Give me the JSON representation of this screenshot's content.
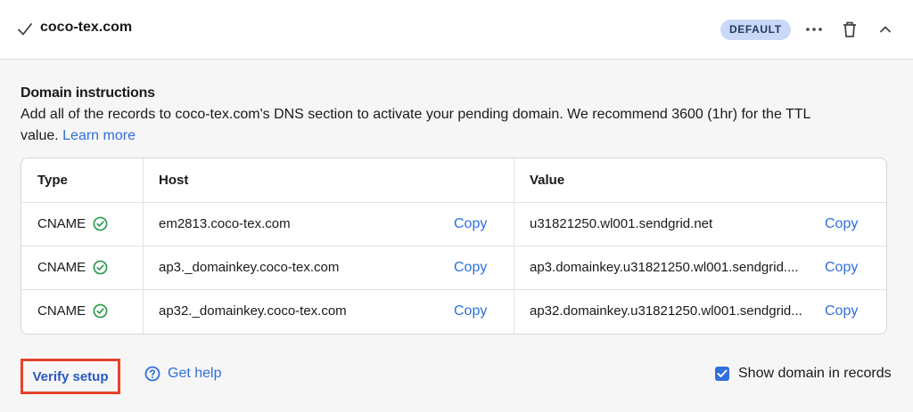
{
  "header": {
    "domain": "coco-tex.com",
    "badge": "DEFAULT",
    "icons": [
      "check-icon",
      "more-icon",
      "trash-icon",
      "chevron-up-icon"
    ]
  },
  "instructions": {
    "title": "Domain instructions",
    "text": "Add all of the records to coco-tex.com's DNS section to activate your pending domain. We recommend 3600 (1hr) for the TTL value.",
    "learn_more": "Learn more"
  },
  "table": {
    "headers": {
      "type": "Type",
      "host": "Host",
      "value": "Value"
    },
    "rows": [
      {
        "type": "CNAME",
        "host": "em2813.coco-tex.com",
        "host_copy": "Copy",
        "value": "u31821250.wl001.sendgrid.net",
        "value_copy": "Copy"
      },
      {
        "type": "CNAME",
        "host": "ap3._domainkey.coco-tex.com",
        "host_copy": "Copy",
        "value": "ap3.domainkey.u31821250.wl001.sendgrid....",
        "value_copy": "Copy"
      },
      {
        "type": "CNAME",
        "host": "ap32._domainkey.coco-tex.com",
        "host_copy": "Copy",
        "value": "ap32.domainkey.u31821250.wl001.sendgrid...",
        "value_copy": "Copy"
      }
    ]
  },
  "footer": {
    "verify": "Verify setup",
    "help": "Get help",
    "show_domain": "Show domain in records",
    "show_domain_checked": true
  },
  "colors": {
    "accent": "#2f6fde",
    "badge_bg": "#c9d8f6",
    "verify_border": "#e8412b",
    "status_green": "#2e9b4f"
  }
}
